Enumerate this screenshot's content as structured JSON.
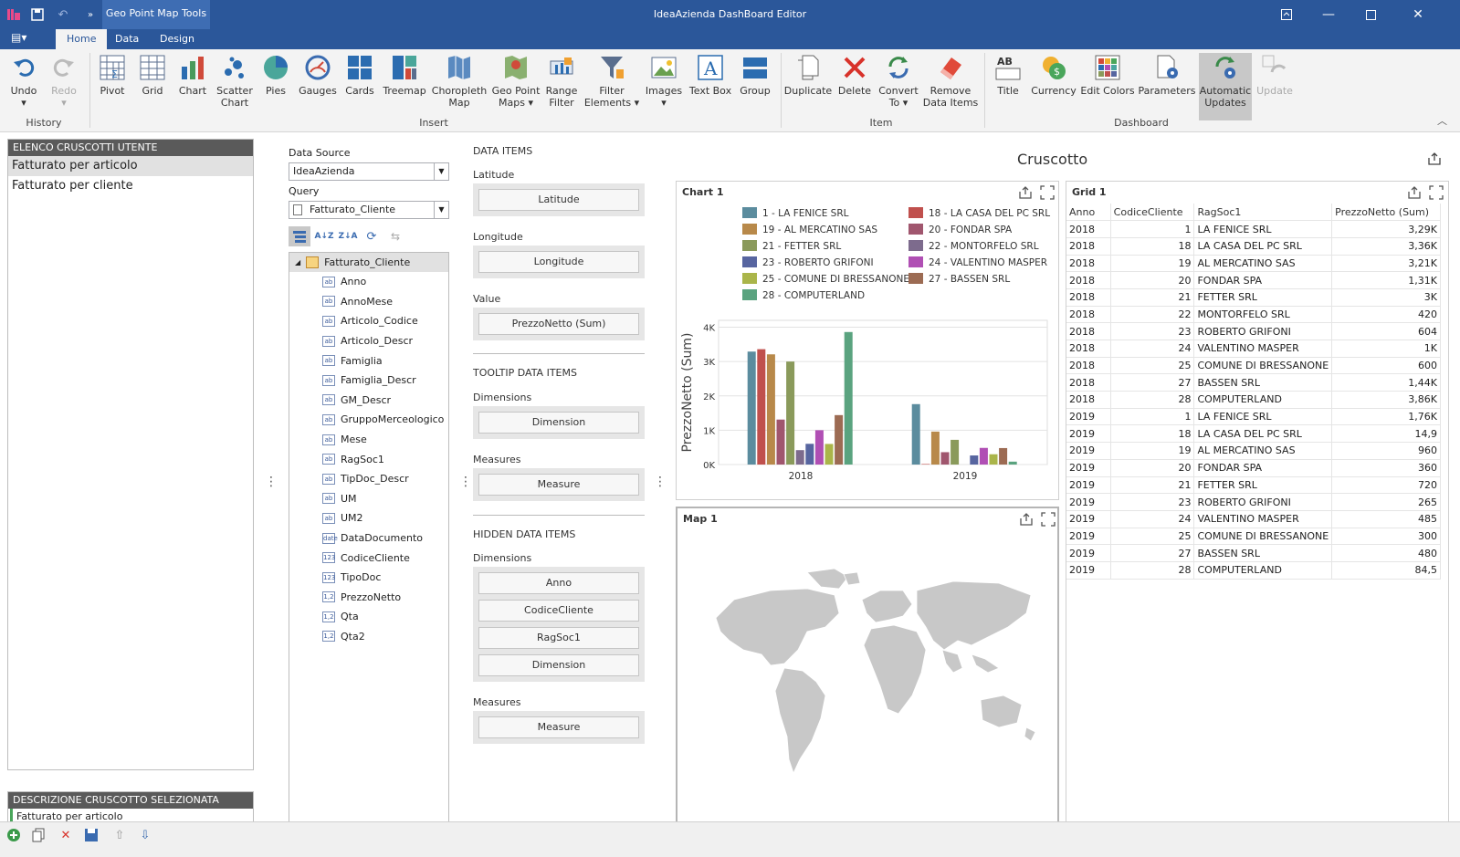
{
  "window": {
    "title": "IdeaAzienda DashBoard Editor",
    "context_tab": "Geo Point Map Tools"
  },
  "tabs": [
    {
      "label": "Home",
      "active": true
    },
    {
      "label": "Data",
      "active": false
    },
    {
      "label": "Design",
      "active": false
    }
  ],
  "ribbon": {
    "history": {
      "label": "History",
      "undo": "Undo",
      "redo": "Redo"
    },
    "insert": {
      "label": "Insert",
      "pivot": "Pivot",
      "grid": "Grid",
      "chart": "Chart",
      "scatter1": "Scatter",
      "scatter2": "Chart",
      "pies": "Pies",
      "gauges": "Gauges",
      "cards": "Cards",
      "treemap": "Treemap",
      "choro1": "Choropleth",
      "choro2": "Map",
      "geo1": "Geo Point",
      "geo2": "Maps",
      "range1": "Range",
      "range2": "Filter",
      "filter1": "Filter",
      "filter2": "Elements",
      "images": "Images",
      "textbox": "Text Box",
      "group": "Group"
    },
    "item": {
      "label": "Item",
      "duplicate": "Duplicate",
      "delete": "Delete",
      "convert1": "Convert",
      "convert2": "To",
      "remove1": "Remove",
      "remove2": "Data Items"
    },
    "dashboard": {
      "label": "Dashboard",
      "title": "Title",
      "currency": "Currency",
      "edit_colors": "Edit Colors",
      "parameters": "Parameters",
      "auto1": "Automatic",
      "auto2": "Updates",
      "update": "Update"
    }
  },
  "left_panel": {
    "header": "ELENCO CRUSCOTTI UTENTE",
    "items": [
      "Fatturato per articolo",
      "Fatturato per cliente"
    ],
    "desc_header": "DESCRIZIONE CRUSCOTTO SELEZIONATA",
    "desc_value": "Fatturato per articolo"
  },
  "field_list": {
    "data_source_label": "Data Source",
    "data_source_value": "IdeaAzienda",
    "query_label": "Query",
    "query_value": "Fatturato_Cliente",
    "root": "Fatturato_Cliente",
    "fields": [
      {
        "name": "Anno",
        "type": "ab"
      },
      {
        "name": "AnnoMese",
        "type": "ab"
      },
      {
        "name": "Articolo_Codice",
        "type": "ab"
      },
      {
        "name": "Articolo_Descr",
        "type": "ab"
      },
      {
        "name": "Famiglia",
        "type": "ab"
      },
      {
        "name": "Famiglia_Descr",
        "type": "ab"
      },
      {
        "name": "GM_Descr",
        "type": "ab"
      },
      {
        "name": "GruppoMerceologico",
        "type": "ab"
      },
      {
        "name": "Mese",
        "type": "ab"
      },
      {
        "name": "RagSoc1",
        "type": "ab"
      },
      {
        "name": "TipDoc_Descr",
        "type": "ab"
      },
      {
        "name": "UM",
        "type": "ab"
      },
      {
        "name": "UM2",
        "type": "ab"
      },
      {
        "name": "DataDocumento",
        "type": "date"
      },
      {
        "name": "CodiceCliente",
        "type": "123"
      },
      {
        "name": "TipoDoc",
        "type": "123"
      },
      {
        "name": "PrezzoNetto",
        "type": "1,2"
      },
      {
        "name": "Qta",
        "type": "1,2"
      },
      {
        "name": "Qta2",
        "type": "1,2"
      }
    ]
  },
  "data_items": {
    "header": "DATA ITEMS",
    "latitude_label": "Latitude",
    "latitude_btn": "Latitude",
    "longitude_label": "Longitude",
    "longitude_btn": "Longitude",
    "value_label": "Value",
    "value_btn": "PrezzoNetto (Sum)",
    "tooltip_header": "TOOLTIP DATA ITEMS",
    "tt_dim_label": "Dimensions",
    "tt_dim_btn": "Dimension",
    "tt_meas_label": "Measures",
    "tt_meas_btn": "Measure",
    "hidden_header": "HIDDEN DATA ITEMS",
    "h_dim_label": "Dimensions",
    "h_dims": [
      "Anno",
      "CodiceCliente",
      "RagSoc1",
      "Dimension"
    ],
    "h_meas_label": "Measures",
    "h_meas_btn": "Measure"
  },
  "dashboard": {
    "title": "Cruscotto",
    "chart_title": "Chart 1",
    "map_title": "Map 1",
    "grid_title": "Grid 1"
  },
  "chart_data": {
    "type": "bar",
    "categories": [
      "2018",
      "2019"
    ],
    "ylabel": "PrezzoNetto (Sum)",
    "ylim": [
      0,
      4200
    ],
    "yticks": [
      "0K",
      "1K",
      "2K",
      "3K",
      "4K"
    ],
    "series": [
      {
        "name": "1 - LA FENICE SRL",
        "color": "#5b8c9e",
        "values": [
          3290,
          1760
        ]
      },
      {
        "name": "18 - LA CASA DEL PC SRL",
        "color": "#c0504d",
        "values": [
          3360,
          14.9
        ]
      },
      {
        "name": "19 - AL MERCATINO SAS",
        "color": "#b8894a",
        "values": [
          3210,
          960
        ]
      },
      {
        "name": "20 - FONDAR SPA",
        "color": "#a0566e",
        "values": [
          1310,
          360
        ]
      },
      {
        "name": "21 - FETTER SRL",
        "color": "#8a9a5b",
        "values": [
          3000,
          720
        ]
      },
      {
        "name": "22 - MONTORFELO SRL",
        "color": "#7d6b8d",
        "values": [
          420,
          0
        ]
      },
      {
        "name": "23 - ROBERTO GRIFONI",
        "color": "#5765a0",
        "values": [
          604,
          265
        ]
      },
      {
        "name": "24 - VALENTINO MASPER",
        "color": "#b04fb4",
        "values": [
          1000,
          485
        ]
      },
      {
        "name": "25 - COMUNE DI BRESSANONE",
        "color": "#aab54a",
        "values": [
          600,
          300
        ]
      },
      {
        "name": "27 - BASSEN SRL",
        "color": "#9c6b53",
        "values": [
          1440,
          480
        ]
      },
      {
        "name": "28 - COMPUTERLAND",
        "color": "#5aa37f",
        "values": [
          3860,
          84.5
        ]
      }
    ]
  },
  "grid": {
    "columns": [
      "Anno",
      "CodiceCliente",
      "RagSoc1",
      "PrezzoNetto (Sum)"
    ],
    "rows": [
      [
        "2018",
        "1",
        "LA FENICE SRL",
        "3,29K"
      ],
      [
        "2018",
        "18",
        "LA CASA DEL PC SRL",
        "3,36K"
      ],
      [
        "2018",
        "19",
        "AL MERCATINO SAS",
        "3,21K"
      ],
      [
        "2018",
        "20",
        "FONDAR SPA",
        "1,31K"
      ],
      [
        "2018",
        "21",
        "FETTER SRL",
        "3K"
      ],
      [
        "2018",
        "22",
        "MONTORFELO SRL",
        "420"
      ],
      [
        "2018",
        "23",
        "ROBERTO GRIFONI",
        "604"
      ],
      [
        "2018",
        "24",
        "VALENTINO MASPER",
        "1K"
      ],
      [
        "2018",
        "25",
        "COMUNE DI BRESSANONE",
        "600"
      ],
      [
        "2018",
        "27",
        "BASSEN SRL",
        "1,44K"
      ],
      [
        "2018",
        "28",
        "COMPUTERLAND",
        "3,86K"
      ],
      [
        "2019",
        "1",
        "LA FENICE SRL",
        "1,76K"
      ],
      [
        "2019",
        "18",
        "LA CASA DEL PC SRL",
        "14,9"
      ],
      [
        "2019",
        "19",
        "AL MERCATINO SAS",
        "960"
      ],
      [
        "2019",
        "20",
        "FONDAR SPA",
        "360"
      ],
      [
        "2019",
        "21",
        "FETTER SRL",
        "720"
      ],
      [
        "2019",
        "23",
        "ROBERTO GRIFONI",
        "265"
      ],
      [
        "2019",
        "24",
        "VALENTINO MASPER",
        "485"
      ],
      [
        "2019",
        "25",
        "COMUNE DI BRESSANONE",
        "300"
      ],
      [
        "2019",
        "27",
        "BASSEN SRL",
        "480"
      ],
      [
        "2019",
        "28",
        "COMPUTERLAND",
        "84,5"
      ]
    ]
  }
}
